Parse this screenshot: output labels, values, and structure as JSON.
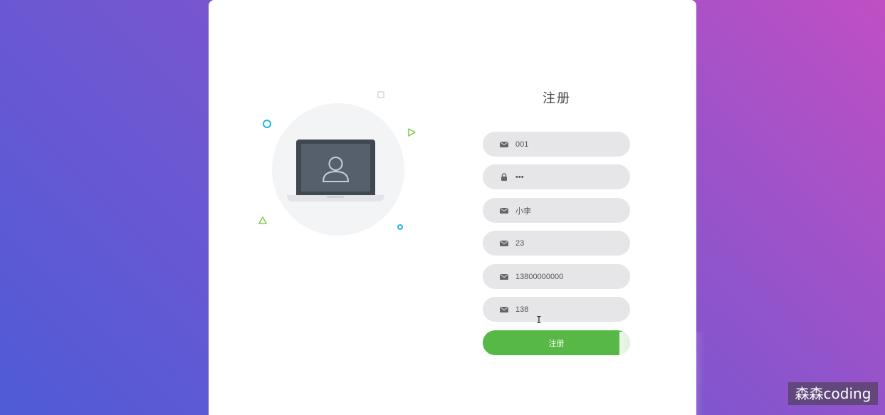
{
  "form": {
    "title": "注册",
    "fields": [
      {
        "icon": "envelope-icon",
        "value": "001"
      },
      {
        "icon": "lock-icon",
        "value": "•••"
      },
      {
        "icon": "envelope-icon",
        "value": "小李"
      },
      {
        "icon": "envelope-icon",
        "value": "23"
      },
      {
        "icon": "envelope-icon",
        "value": "13800000000"
      },
      {
        "icon": "envelope-icon",
        "value": "138"
      }
    ],
    "submit_label": "注册"
  },
  "watermark": "森森coding",
  "colors": {
    "accent_green": "#57b846",
    "field_bg": "#e6e6e8",
    "deco_cyan": "#1fb6e0",
    "deco_green": "#7ccc4a",
    "bg_gradient_start": "#4f5bd6",
    "bg_gradient_end": "#c04fc3"
  }
}
